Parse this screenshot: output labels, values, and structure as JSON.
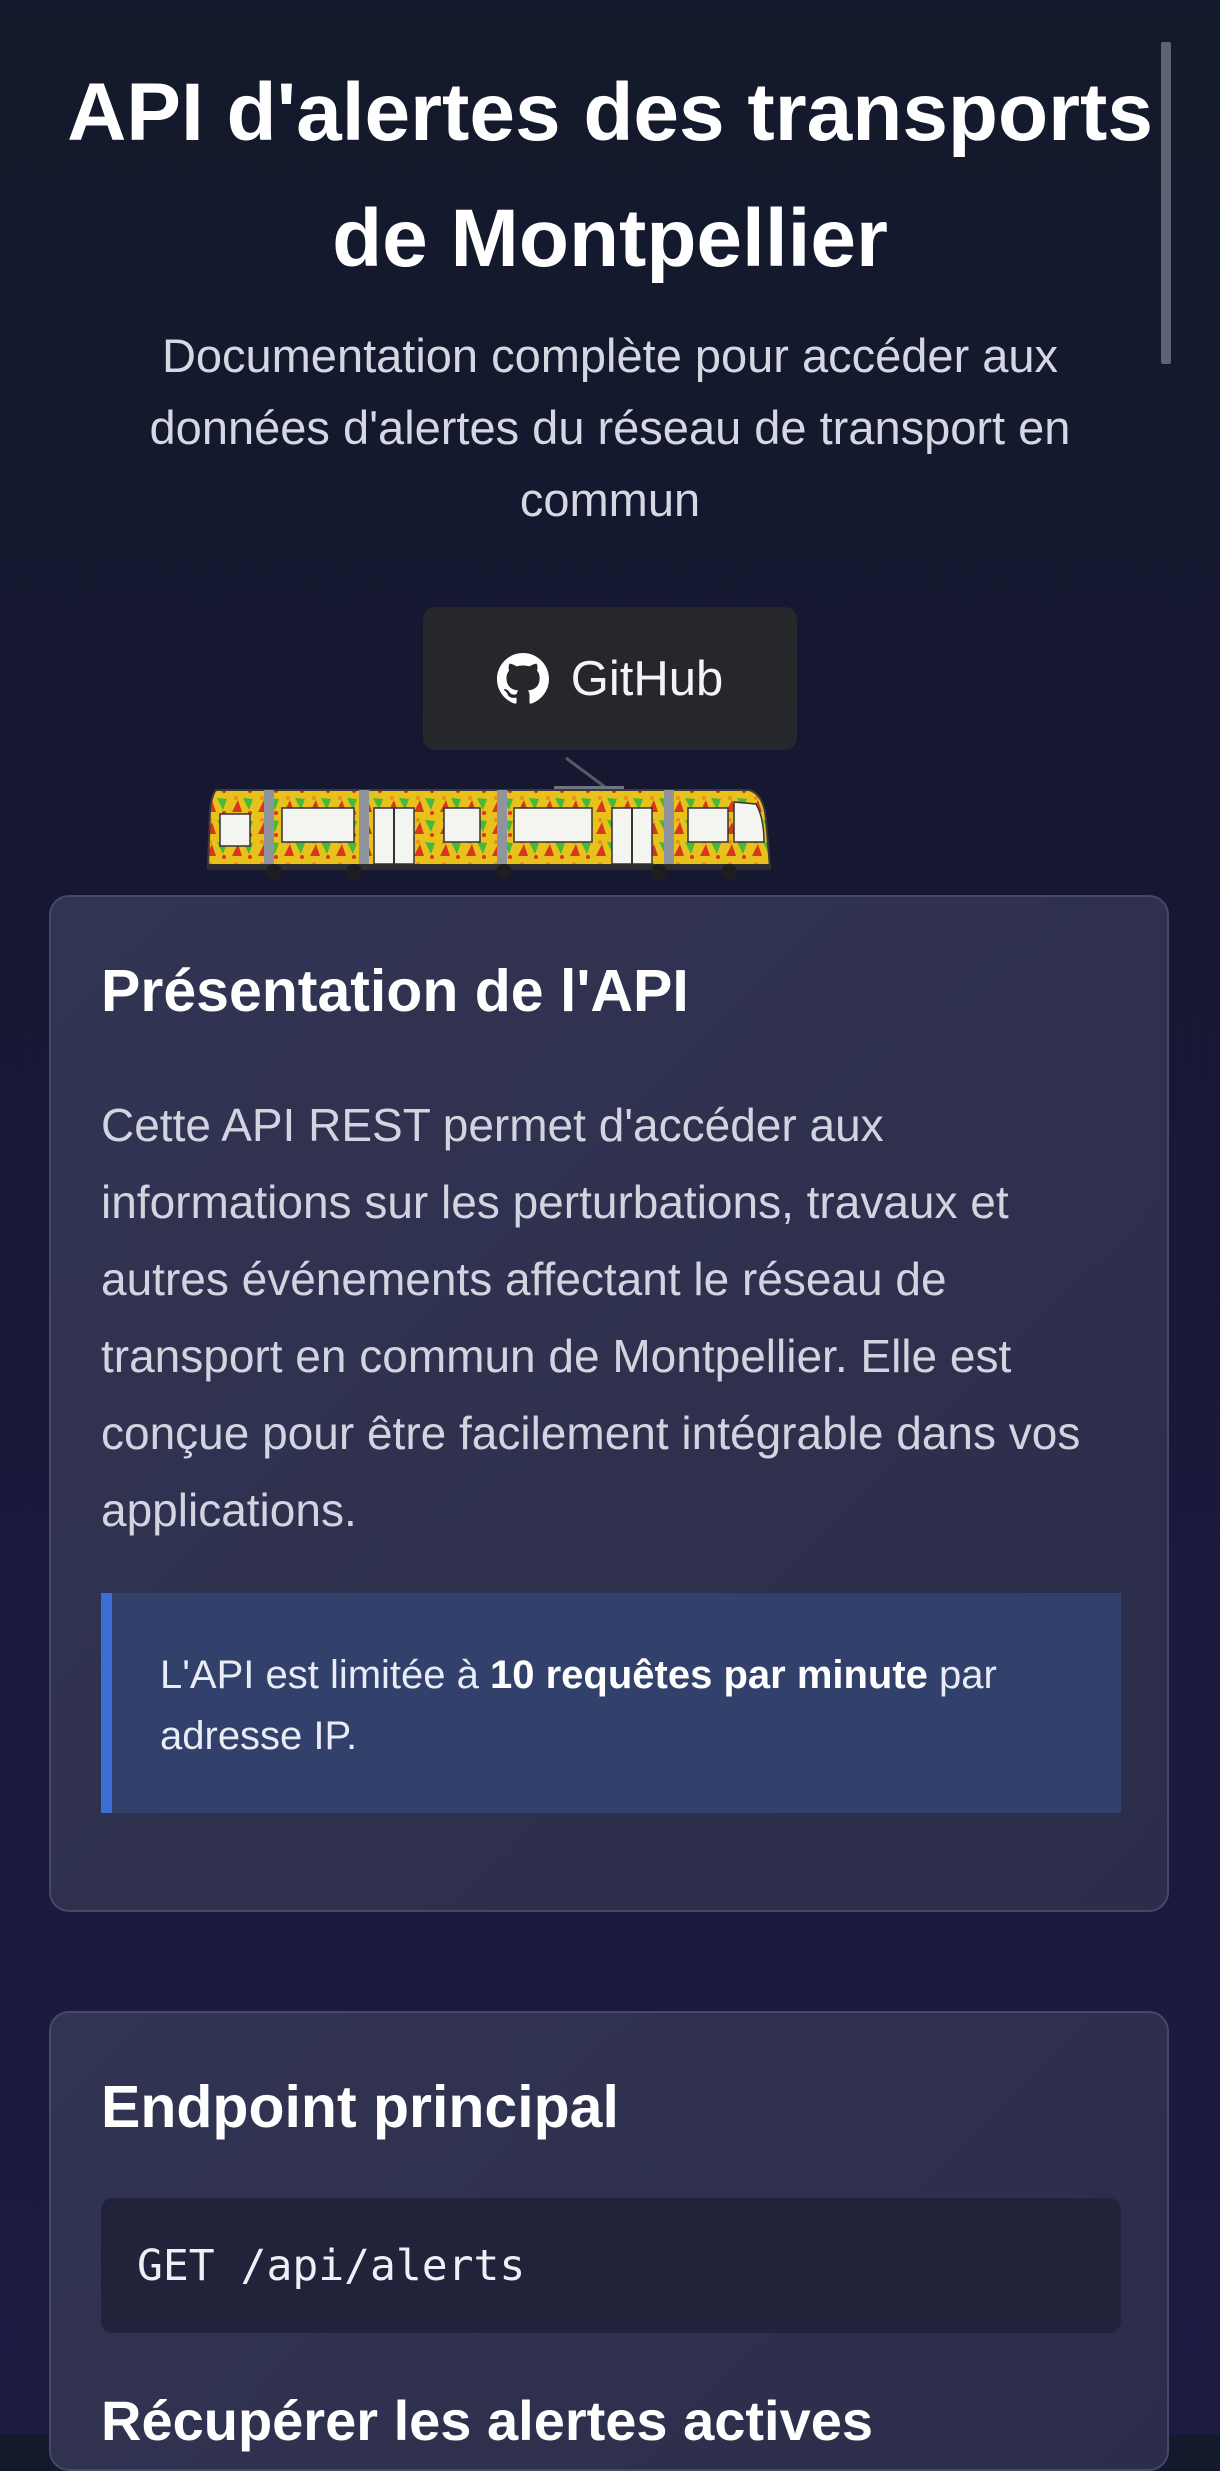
{
  "hero": {
    "title": "API d'alertes des transports de Montpellier",
    "subtitle": "Documentation complète pour accéder aux données d'alertes du réseau de transport en commun"
  },
  "github_button": {
    "label": "GitHub",
    "icon": "github-icon"
  },
  "illustration": {
    "icon": "tram-illustration",
    "colors": {
      "body": "#e8c21a",
      "stripe": "#d9351f",
      "leaf": "#46b83a",
      "window": "#f4f4f0"
    }
  },
  "presentation": {
    "title": "Présentation de l'API",
    "paragraph": "Cette API REST permet d'accéder aux informations sur les perturbations, travaux et autres événements affectant le réseau de transport en commun de Montpellier. Elle est conçue pour être facilement intégrable dans vos applications.",
    "notice": {
      "prefix": "L'API est limitée à ",
      "highlight": "10 requêtes par minute",
      "suffix": " par adresse IP."
    }
  },
  "endpoint": {
    "title": "Endpoint principal",
    "code": "GET /api/alerts",
    "next_heading": "Récupérer les alertes actives"
  },
  "colors": {
    "notice_accent": "#3b6fd3",
    "notice_background": "#32416b",
    "card_background": "#313452",
    "button_background": "#25272b"
  }
}
